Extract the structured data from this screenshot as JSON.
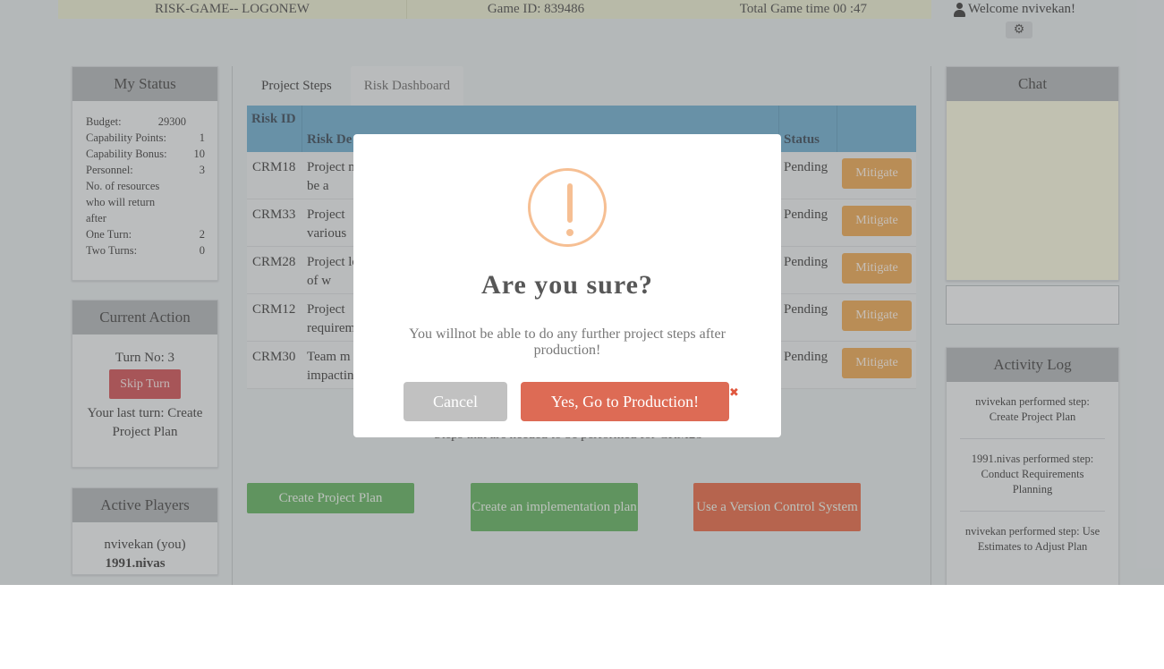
{
  "topbar": {
    "logo": "RISK-GAME-- LOGONEW",
    "game_id": "Game ID: 839486",
    "total_time": "Total Game time 00 :47"
  },
  "user": {
    "welcome": "Welcome   nvivekan!"
  },
  "my_status": {
    "title": "My Status",
    "rows": [
      {
        "label": "Budget:",
        "value": "29300"
      },
      {
        "label": "Capability  Points:",
        "value": "1"
      },
      {
        "label": "Capability  Bonus:",
        "value": "10"
      },
      {
        "label": "Personnel:",
        "value": "3"
      },
      {
        "label": "No. of resources who will return after",
        "value": ""
      },
      {
        "label": "One Turn:",
        "value": "2"
      },
      {
        "label": "Two Turns:",
        "value": "0"
      }
    ]
  },
  "current_action": {
    "title": "Current  Action",
    "turn": "Turn  No: 3",
    "skip_label": "Skip Turn",
    "last_turn": "Your last turn: Create Project Plan"
  },
  "active_players": {
    "title": "Active Players",
    "players": [
      "nvivekan  (you)",
      "1991.nivas"
    ]
  },
  "tabs": [
    "Project  Steps",
    "Risk Dashboard"
  ],
  "risk_table": {
    "headers": [
      "Risk ID",
      "Risk  De",
      "Status",
      ""
    ],
    "rows": [
      {
        "id": "CRM18",
        "desc": "Project  not be a",
        "status": "Pending",
        "action": "Mitigate"
      },
      {
        "id": "CRM33",
        "desc": "Project  various",
        "status": "Pending",
        "action": "Mitigate"
      },
      {
        "id": "CRM28",
        "desc": "Project  loss of w",
        "status": "Pending",
        "action": "Mitigate"
      },
      {
        "id": "CRM12",
        "desc": "Project  requirem",
        "status": "Pending",
        "action": "Mitigate"
      },
      {
        "id": "CRM30",
        "desc": "Team m impactin",
        "status": "Pending",
        "action": "Mitigate"
      }
    ]
  },
  "steps_caption": "Steps  that  are  needed  to  be  performed   for CRM28",
  "step_buttons": [
    "Create  Project  Plan",
    "Create  an implementation   plan",
    "Use a Version  Control System"
  ],
  "colors": {
    "green": "#4ca54a",
    "orange": "#e0532e",
    "mitigate": "#e59a3b",
    "confirm": "#dd6b55"
  },
  "chat": {
    "title": "Chat"
  },
  "activity_log": {
    "title": "Activity Log",
    "entries": [
      "nvivekan  performed  step: Create Project Plan",
      "1991.nivas performed  step: Conduct  Requirements Planning",
      "nvivekan  performed  step: Use Estimates  to Adjust Plan"
    ]
  },
  "modal": {
    "icon": "warning-icon",
    "title": "Are you  sure?",
    "text": "You willnot be able to do any further project steps  after production!",
    "cancel": "Cancel",
    "confirm": "Yes,  Go  to Production!",
    "close": "✖"
  }
}
